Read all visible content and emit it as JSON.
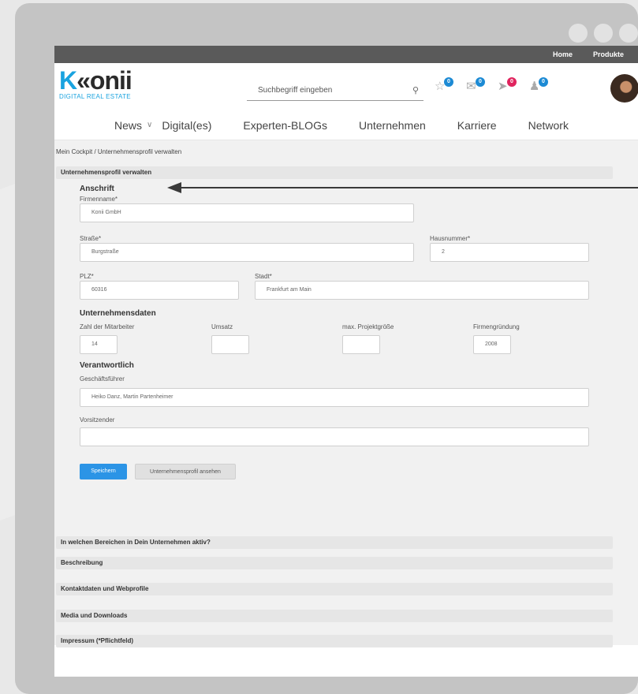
{
  "topbar": {
    "home": "Home",
    "produkte": "Produkte"
  },
  "logo": {
    "main_k": "K",
    "main_rest": "«onii",
    "sub": "DIGITAL REAL ESTATE"
  },
  "search": {
    "placeholder": "Suchbegriff eingeben"
  },
  "badges": {
    "star": "0",
    "mail": "0",
    "send": "0",
    "users": "0"
  },
  "nav": {
    "news": "News",
    "digital": "Digital(es)",
    "experten": "Experten-BLOGs",
    "unternehmen": "Unternehmen",
    "karriere": "Karriere",
    "network": "Network"
  },
  "breadcrumb": "Mein Cockpit  /  Unternehmensprofil verwalten",
  "sections": {
    "profile": "Unternehmensprofil verwalten",
    "bereiche": "In welchen Bereichen in Dein Unternehmen aktiv?",
    "beschreibung": "Beschreibung",
    "kontakt": "Kontaktdaten und Webprofile",
    "media": "Media und Downloads",
    "impressum": "Impressum (*Pflichtfeld)"
  },
  "form": {
    "anschrift": "Anschrift",
    "firmenname_label": "Firmenname*",
    "firmenname": "Konii GmbH",
    "strasse_label": "Straße*",
    "strasse": "Burgstraße",
    "hausnummer_label": "Hausnummer*",
    "hausnummer": "2",
    "plz_label": "PLZ*",
    "plz": "60316",
    "stadt_label": "Stadt*",
    "stadt": "Frankfurt am Main",
    "unternehmensdaten": "Unternehmensdaten",
    "mitarbeiter_label": "Zahl der Mitarbeiter",
    "mitarbeiter": "14",
    "umsatz_label": "Umsatz",
    "umsatz": "",
    "projekt_label": "max. Projektgröße",
    "projekt": "",
    "gruendung_label": "Firmengründung",
    "gruendung": "2008",
    "verantwortlich": "Verantwortlich",
    "gf_label": "Geschäftsführer",
    "gf": "Heiko Danz, Martin Partenheimer",
    "vorsitz_label": "Vorsitzender",
    "vorsitz": ""
  },
  "buttons": {
    "save": "Speichern",
    "view": "Unternehmensprofil ansehen"
  }
}
